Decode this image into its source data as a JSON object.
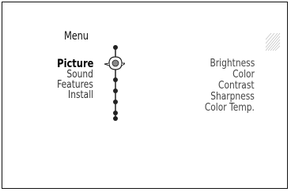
{
  "menu": {
    "title": "Menu",
    "items": [
      {
        "label": "Picture",
        "active": true
      },
      {
        "label": "Sound",
        "active": false
      },
      {
        "label": "Features",
        "active": false
      },
      {
        "label": "Install",
        "active": false
      }
    ]
  },
  "submenu": {
    "items": [
      {
        "label": "Brightness"
      },
      {
        "label": "Color"
      },
      {
        "label": "Contrast"
      },
      {
        "label": "Sharpness"
      },
      {
        "label": "Color Temp."
      }
    ]
  },
  "icons": {
    "navigation_cursor": "nav-cursor-icon",
    "corner_decoration": "hatch-decoration-icon"
  },
  "colors": {
    "text_primary": "#111111",
    "text_secondary": "#444444",
    "border": "#111111"
  }
}
